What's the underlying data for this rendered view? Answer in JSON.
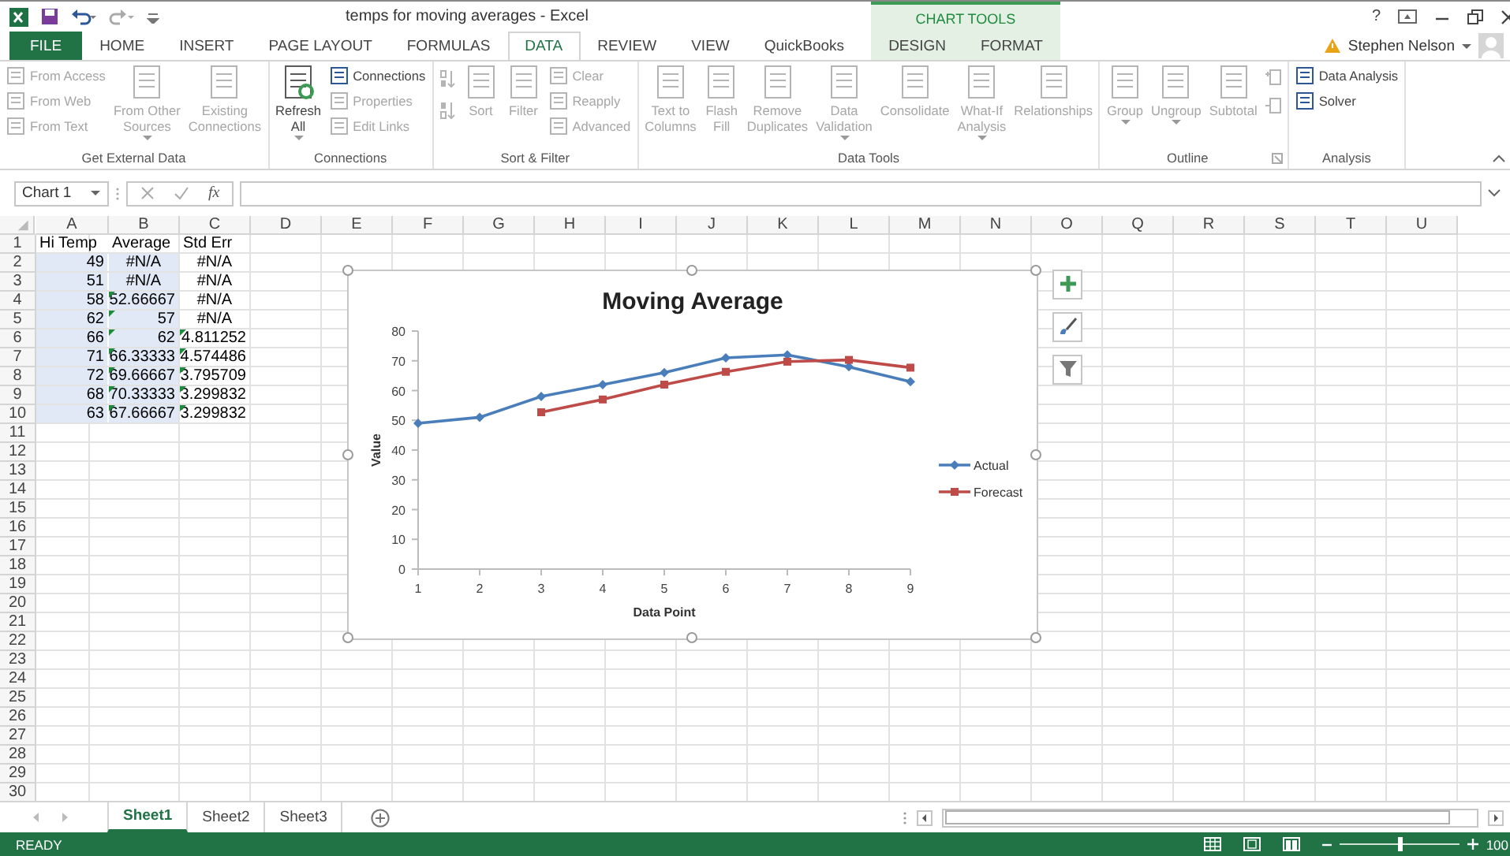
{
  "title_bar": {
    "title": "temps for moving averages - Excel",
    "help": "?"
  },
  "tabs": [
    {
      "label": "FILE",
      "kind": "file",
      "selected": false
    },
    {
      "label": "HOME",
      "kind": "tab",
      "selected": false
    },
    {
      "label": "INSERT",
      "kind": "tab",
      "selected": false
    },
    {
      "label": "PAGE LAYOUT",
      "kind": "tab",
      "selected": false
    },
    {
      "label": "FORMULAS",
      "kind": "tab",
      "selected": false
    },
    {
      "label": "DATA",
      "kind": "tab",
      "selected": true
    },
    {
      "label": "REVIEW",
      "kind": "tab",
      "selected": false
    },
    {
      "label": "VIEW",
      "kind": "tab",
      "selected": false
    },
    {
      "label": "QuickBooks",
      "kind": "tab",
      "selected": false
    }
  ],
  "contextual": {
    "label": "CHART TOOLS",
    "tabs": [
      {
        "label": "DESIGN",
        "selected": false
      },
      {
        "label": "FORMAT",
        "selected": false
      }
    ]
  },
  "account": {
    "name": "Stephen Nelson"
  },
  "ribbon": {
    "groups": [
      {
        "label": "Get External Data",
        "items": [
          {
            "kind": "stack",
            "items": [
              {
                "label": "From Access",
                "disabled": true
              },
              {
                "label": "From Web",
                "disabled": true
              },
              {
                "label": "From Text",
                "disabled": true
              }
            ]
          },
          {
            "kind": "large",
            "label": "From Other\nSources",
            "menu": true,
            "disabled": true
          },
          {
            "kind": "large",
            "label": "Existing\nConnections",
            "menu": false,
            "disabled": true
          }
        ]
      },
      {
        "label": "Connections",
        "items": [
          {
            "kind": "large",
            "label": "Refresh\nAll",
            "menu": true,
            "disabled": false
          },
          {
            "kind": "stack",
            "items": [
              {
                "label": "Connections",
                "disabled": false
              },
              {
                "label": "Properties",
                "disabled": true
              },
              {
                "label": "Edit Links",
                "disabled": true
              }
            ]
          }
        ]
      },
      {
        "label": "Sort & Filter",
        "items": [
          {
            "kind": "sort-icons",
            "disabled": true
          },
          {
            "kind": "large",
            "label": "Sort",
            "menu": false,
            "disabled": true
          },
          {
            "kind": "large",
            "label": "Filter",
            "menu": false,
            "disabled": true
          },
          {
            "kind": "stack",
            "items": [
              {
                "label": "Clear",
                "disabled": true
              },
              {
                "label": "Reapply",
                "disabled": true
              },
              {
                "label": "Advanced",
                "disabled": true
              }
            ]
          }
        ]
      },
      {
        "label": "Data Tools",
        "items": [
          {
            "kind": "large",
            "label": "Text to\nColumns",
            "menu": false,
            "disabled": true
          },
          {
            "kind": "large",
            "label": "Flash\nFill",
            "menu": false,
            "disabled": true
          },
          {
            "kind": "large",
            "label": "Remove\nDuplicates",
            "menu": false,
            "disabled": true
          },
          {
            "kind": "large",
            "label": "Data\nValidation",
            "menu": true,
            "disabled": true
          },
          {
            "kind": "large",
            "label": "Consolidate",
            "menu": false,
            "disabled": true
          },
          {
            "kind": "large",
            "label": "What-If\nAnalysis",
            "menu": true,
            "disabled": true
          },
          {
            "kind": "large",
            "label": "Relationships",
            "menu": false,
            "disabled": true
          }
        ]
      },
      {
        "label": "Outline",
        "launcher": true,
        "items": [
          {
            "kind": "large",
            "label": "Group",
            "menu": true,
            "disabled": true
          },
          {
            "kind": "large",
            "label": "Ungroup",
            "menu": true,
            "disabled": true
          },
          {
            "kind": "large",
            "label": "Subtotal",
            "menu": false,
            "disabled": true
          },
          {
            "kind": "icon-stack",
            "disabled": true
          }
        ]
      },
      {
        "label": "Analysis",
        "items": [
          {
            "kind": "stack",
            "items": [
              {
                "label": "Data Analysis",
                "disabled": false
              },
              {
                "label": "Solver",
                "disabled": false
              }
            ]
          }
        ]
      }
    ]
  },
  "formula_bar": {
    "name_box": "Chart 1",
    "fx": "fx"
  },
  "sheet": {
    "columns": [
      "A",
      "B",
      "C",
      "D",
      "E",
      "F",
      "G",
      "H",
      "I",
      "J",
      "K",
      "L",
      "M",
      "N",
      "O",
      "Q",
      "R",
      "S",
      "T",
      "U"
    ],
    "rows": [
      {
        "header": "1",
        "cells": [
          {
            "text": "Hi Temp",
            "kind": "text",
            "highlighted": false,
            "flagged": false
          },
          {
            "text": "Average",
            "kind": "text",
            "highlighted": false,
            "flagged": false
          },
          {
            "text": "Std Err",
            "kind": "text",
            "highlighted": false,
            "flagged": false
          }
        ]
      },
      {
        "header": "2",
        "cells": [
          {
            "text": "49",
            "kind": "number",
            "highlighted": true,
            "flagged": false
          },
          {
            "text": "#N/A",
            "kind": "error",
            "highlighted": true,
            "flagged": false
          },
          {
            "text": "#N/A",
            "kind": "error",
            "highlighted": false,
            "flagged": false
          }
        ]
      },
      {
        "header": "3",
        "cells": [
          {
            "text": "51",
            "kind": "number",
            "highlighted": true,
            "flagged": false
          },
          {
            "text": "#N/A",
            "kind": "error",
            "highlighted": true,
            "flagged": false
          },
          {
            "text": "#N/A",
            "kind": "error",
            "highlighted": false,
            "flagged": false
          }
        ]
      },
      {
        "header": "4",
        "cells": [
          {
            "text": "58",
            "kind": "number",
            "highlighted": true,
            "flagged": false
          },
          {
            "text": "52.66667",
            "kind": "number",
            "highlighted": true,
            "flagged": true
          },
          {
            "text": "#N/A",
            "kind": "error",
            "highlighted": false,
            "flagged": false
          }
        ]
      },
      {
        "header": "5",
        "cells": [
          {
            "text": "62",
            "kind": "number",
            "highlighted": true,
            "flagged": false
          },
          {
            "text": "57",
            "kind": "number",
            "highlighted": true,
            "flagged": true
          },
          {
            "text": "#N/A",
            "kind": "error",
            "highlighted": false,
            "flagged": false
          }
        ]
      },
      {
        "header": "6",
        "cells": [
          {
            "text": "66",
            "kind": "number",
            "highlighted": true,
            "flagged": false
          },
          {
            "text": "62",
            "kind": "number",
            "highlighted": true,
            "flagged": true
          },
          {
            "text": "4.811252",
            "kind": "number",
            "highlighted": false,
            "flagged": true
          }
        ]
      },
      {
        "header": "7",
        "cells": [
          {
            "text": "71",
            "kind": "number",
            "highlighted": true,
            "flagged": false
          },
          {
            "text": "66.33333",
            "kind": "number",
            "highlighted": true,
            "flagged": true
          },
          {
            "text": "4.574486",
            "kind": "number",
            "highlighted": false,
            "flagged": true
          }
        ]
      },
      {
        "header": "8",
        "cells": [
          {
            "text": "72",
            "kind": "number",
            "highlighted": true,
            "flagged": false
          },
          {
            "text": "69.66667",
            "kind": "number",
            "highlighted": true,
            "flagged": true
          },
          {
            "text": "3.795709",
            "kind": "number",
            "highlighted": false,
            "flagged": true
          }
        ]
      },
      {
        "header": "9",
        "cells": [
          {
            "text": "68",
            "kind": "number",
            "highlighted": true,
            "flagged": false
          },
          {
            "text": "70.33333",
            "kind": "number",
            "highlighted": true,
            "flagged": true
          },
          {
            "text": "3.299832",
            "kind": "number",
            "highlighted": false,
            "flagged": true
          }
        ]
      },
      {
        "header": "10",
        "cells": [
          {
            "text": "63",
            "kind": "number",
            "highlighted": true,
            "flagged": false
          },
          {
            "text": "67.66667",
            "kind": "number",
            "highlighted": true,
            "flagged": true
          },
          {
            "text": "3.299832",
            "kind": "number",
            "highlighted": false,
            "flagged": true
          }
        ]
      },
      {
        "header": "11"
      },
      {
        "header": "12"
      },
      {
        "header": "13"
      },
      {
        "header": "14"
      },
      {
        "header": "15"
      },
      {
        "header": "16"
      },
      {
        "header": "17"
      },
      {
        "header": "18"
      },
      {
        "header": "19"
      },
      {
        "header": "20"
      },
      {
        "header": "21"
      },
      {
        "header": "22"
      },
      {
        "header": "23"
      },
      {
        "header": "24"
      },
      {
        "header": "25"
      },
      {
        "header": "26"
      },
      {
        "header": "27"
      },
      {
        "header": "28"
      },
      {
        "header": "29"
      },
      {
        "header": "30"
      }
    ]
  },
  "chart": {
    "selected": true,
    "chart_data": {
      "type": "line",
      "title": "Moving Average",
      "xlabel": "Data Point",
      "ylabel": "Value",
      "x": [
        1,
        2,
        3,
        4,
        5,
        6,
        7,
        8,
        9
      ],
      "series": [
        {
          "name": "Actual",
          "color": "#4a7ebb",
          "marker": "diamond",
          "values": [
            49,
            51,
            58,
            62,
            66,
            71,
            72,
            68,
            63
          ]
        },
        {
          "name": "Forecast",
          "color": "#be4b48",
          "marker": "square",
          "values": [
            null,
            null,
            52.7,
            57,
            62,
            66.3,
            69.7,
            70.3,
            67.7
          ]
        }
      ],
      "legend": true,
      "xlim": [
        1,
        9
      ],
      "ylim": [
        0,
        80
      ],
      "xticks": [
        {
          "value": 1,
          "label": "1"
        },
        {
          "value": 2,
          "label": "2"
        },
        {
          "value": 3,
          "label": "3"
        },
        {
          "value": 4,
          "label": "4"
        },
        {
          "value": 5,
          "label": "5"
        },
        {
          "value": 6,
          "label": "6"
        },
        {
          "value": 7,
          "label": "7"
        },
        {
          "value": 8,
          "label": "8"
        },
        {
          "value": 9,
          "label": "9"
        }
      ],
      "yticks": [
        {
          "value": 0,
          "label": "0"
        },
        {
          "value": 10,
          "label": "10"
        },
        {
          "value": 20,
          "label": "20"
        },
        {
          "value": 30,
          "label": "30"
        },
        {
          "value": 40,
          "label": "40"
        },
        {
          "value": 50,
          "label": "50"
        },
        {
          "value": 60,
          "label": "60"
        },
        {
          "value": 70,
          "label": "70"
        },
        {
          "value": 80,
          "label": "80"
        }
      ]
    }
  },
  "sheet_tabs": [
    {
      "label": "Sheet1",
      "selected": true
    },
    {
      "label": "Sheet2",
      "selected": false
    },
    {
      "label": "Sheet3",
      "selected": false
    }
  ],
  "status_bar": {
    "mode": "READY",
    "zoom": {
      "level": 0.5,
      "reading": "100"
    }
  }
}
